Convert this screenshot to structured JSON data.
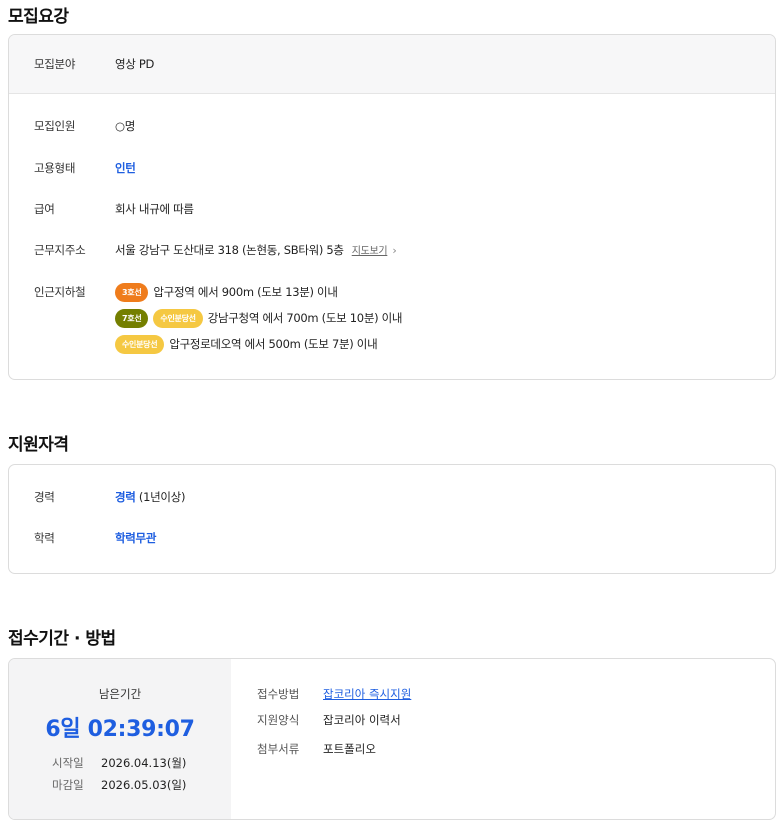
{
  "recruit": {
    "title": "모집요강",
    "field": {
      "label": "모집분야",
      "value": "영상 PD"
    },
    "headcount": {
      "label": "모집인원",
      "value": "○명"
    },
    "employment": {
      "label": "고용형태",
      "value": "인턴"
    },
    "salary": {
      "label": "급여",
      "value": "회사 내규에 따름"
    },
    "location": {
      "label": "근무지주소",
      "value": "서울 강남구 도산대로 318 (논현동, SB타워) 5층",
      "map_link": "지도보기",
      "chevron_icon": "chevron-right-icon"
    },
    "subway": {
      "label": "인근지하철",
      "lines": [
        {
          "badges": [
            {
              "text": "3호선",
              "color": "#ef7c1c"
            }
          ],
          "text": "압구정역 에서 900m (도보 13분) 이내"
        },
        {
          "badges": [
            {
              "text": "7호선",
              "color": "#747f00"
            },
            {
              "text": "수인분당선",
              "color": "#f5c842"
            }
          ],
          "text": "강남구청역 에서 700m (도보 10분) 이내"
        },
        {
          "badges": [
            {
              "text": "수인분당선",
              "color": "#f5c842"
            }
          ],
          "text": "압구정로데오역 에서 500m (도보 7분) 이내"
        }
      ]
    }
  },
  "qualification": {
    "title": "지원자격",
    "career": {
      "label": "경력",
      "value": "경력",
      "note": " (1년이상)"
    },
    "education": {
      "label": "학력",
      "value": "학력무관"
    }
  },
  "apply": {
    "title": "접수기간 · 방법",
    "remaining_label": "남은기간",
    "remaining_time": "6일 02:39:07",
    "start": {
      "label": "시작일",
      "value": "2026.04.13(월)"
    },
    "end": {
      "label": "마감일",
      "value": "2026.05.03(일)"
    },
    "method": {
      "label": "접수방법",
      "value": "잡코리아 즉시지원"
    },
    "form": {
      "label": "지원양식",
      "value": "잡코리아 이력서"
    },
    "attachment": {
      "label": "첨부서류",
      "value": "포트폴리오"
    }
  },
  "colors": {
    "accent": "#1e5ee0"
  }
}
